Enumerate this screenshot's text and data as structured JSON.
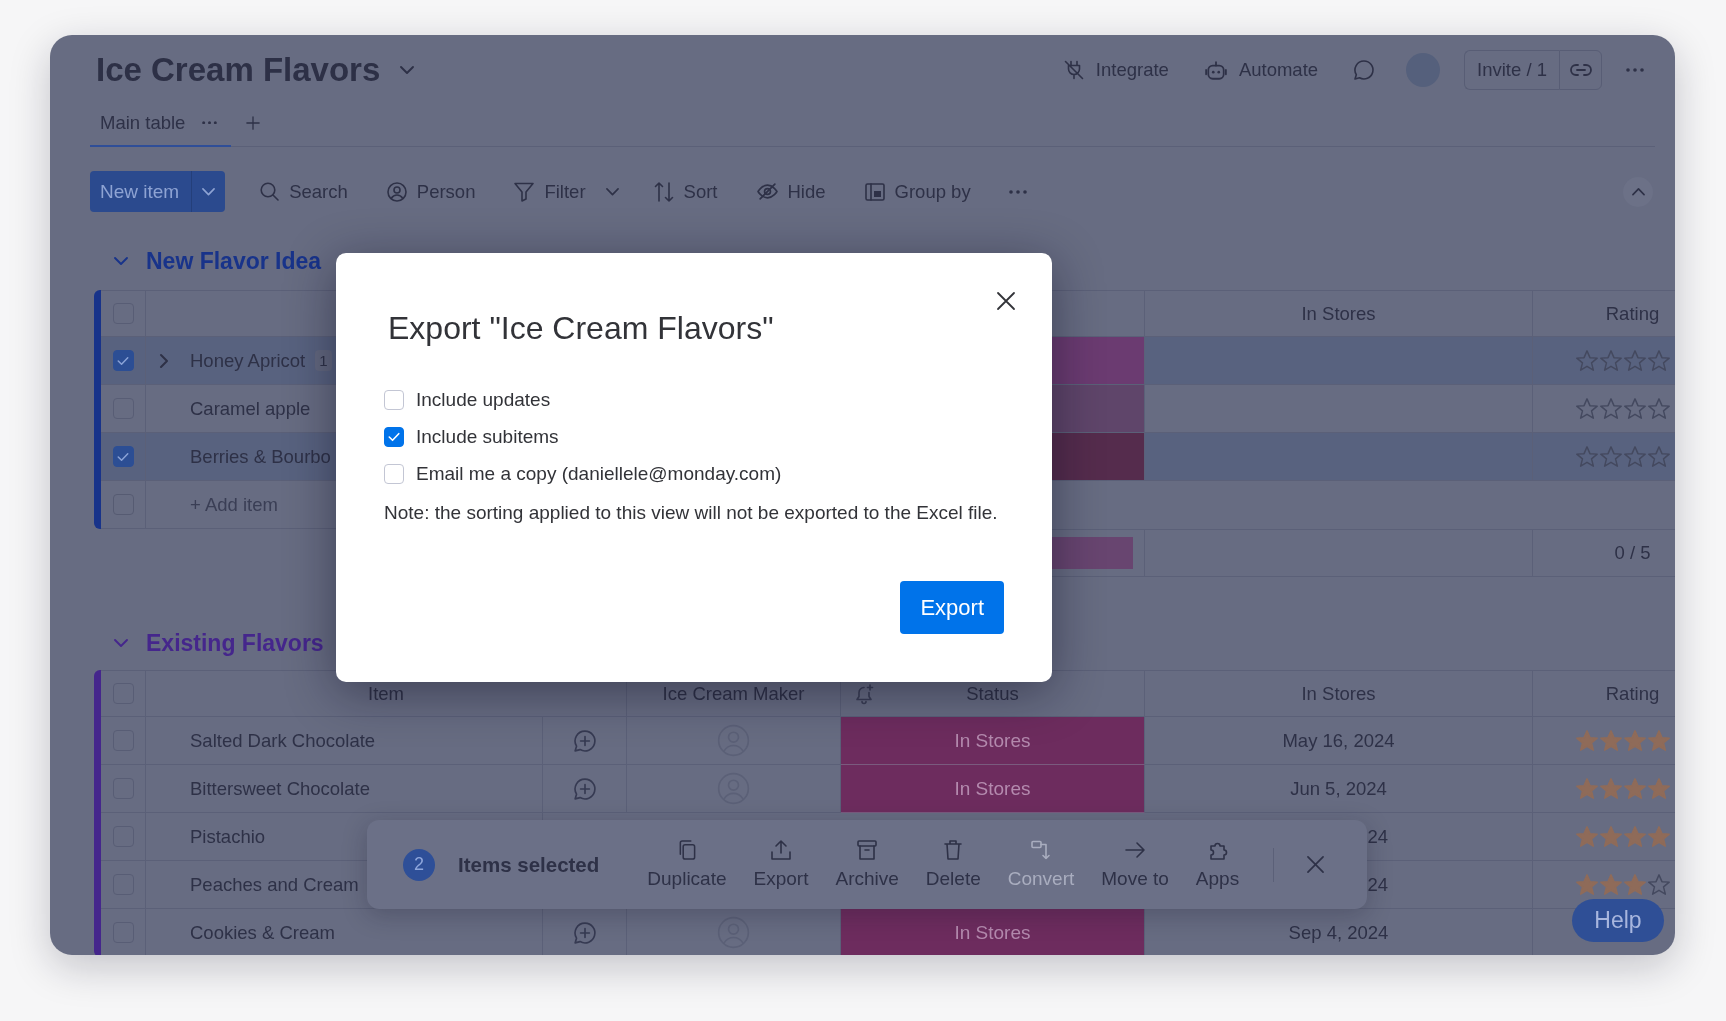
{
  "board": {
    "title": "Ice Cream Flavors"
  },
  "header_actions": [
    {
      "kind": "integrate",
      "label": "Integrate"
    },
    {
      "kind": "automate",
      "label": "Automate"
    }
  ],
  "invite": {
    "label": "Invite / 1"
  },
  "views": [
    {
      "label": "Main table",
      "selected": true
    }
  ],
  "toolbar": {
    "new_item": "New item",
    "tools": [
      {
        "kind": "search",
        "label": "Search"
      },
      {
        "kind": "person",
        "label": "Person"
      },
      {
        "kind": "filter",
        "label": "Filter"
      },
      {
        "kind": "sort",
        "label": "Sort"
      },
      {
        "kind": "hide",
        "label": "Hide"
      },
      {
        "kind": "group",
        "label": "Group by"
      }
    ]
  },
  "groups": [
    {
      "title": "New Flavor Idea",
      "color": "#18338a",
      "expanded": true,
      "select_all": false,
      "columns": [
        {
          "kind": "in_stores",
          "label": "In Stores"
        },
        {
          "kind": "rating",
          "label": "Rating"
        }
      ],
      "rows": [
        {
          "kind": "under_dialog",
          "name": "Honey Apricot",
          "subitems": "1",
          "checked": true,
          "status": {
            "color": "#6b3b71"
          },
          "stars": 0
        },
        {
          "kind": "under_dialog",
          "name": "Caramel apple",
          "checked": false,
          "status": {
            "color": "#5f456a"
          },
          "stars": 0
        },
        {
          "kind": "under_dialog",
          "name": "Berries & Bourbo",
          "checked": true,
          "status": {
            "color": "#552c4d"
          },
          "stars": 0
        }
      ],
      "add_item": {
        "placeholder": "+ Add item",
        "disabled": true
      },
      "summary": {
        "status_bar": {
          "color": "#684570"
        },
        "rating": "0 / 5"
      }
    },
    {
      "title": "Existing Flavors",
      "color": "#45268c",
      "expanded": true,
      "select_all": false,
      "columns": [
        {
          "kind": "item",
          "label": "Item"
        },
        {
          "kind": "maker",
          "label": "Ice Cream Maker"
        },
        {
          "kind": "status",
          "label": "Status"
        },
        {
          "kind": "in_stores",
          "label": "In Stores"
        },
        {
          "kind": "rating",
          "label": "Rating"
        }
      ],
      "rows": [
        {
          "kind": "full",
          "name": "Salted Dark Chocolate",
          "checked": false,
          "status": {
            "label": "In Stores",
            "color": "#6d2c5e"
          },
          "date": "May 16, 2024",
          "stars": 4
        },
        {
          "kind": "full",
          "name": "Bittersweet Chocolate",
          "checked": false,
          "status": {
            "label": "In Stores",
            "color": "#6d2c5e"
          },
          "date": "Jun 5, 2024",
          "stars": 4
        },
        {
          "kind": "under_bar",
          "name": "Pistachio",
          "checked": false,
          "date": "24",
          "stars": 4
        },
        {
          "kind": "under_bar",
          "name": "Peaches and Cream",
          "checked": false,
          "date": "24",
          "stars": 3
        },
        {
          "kind": "full",
          "name": "Cookies & Cream",
          "checked": false,
          "status": {
            "label": "In Stores",
            "color": "#6d2c5e"
          },
          "date": "Sep 4, 2024"
        }
      ]
    }
  ],
  "dialog": {
    "title": "Export \"Ice Cream Flavors\"",
    "options": [
      {
        "label": "Include updates",
        "checked": false
      },
      {
        "label": "Include subitems",
        "checked": true
      },
      {
        "label": "Email me a copy (daniellele@monday.com)",
        "checked": false
      }
    ],
    "note": "Note: the sorting applied to this view will not be exported to the Excel file.",
    "button": "Export"
  },
  "selection": {
    "count": "2",
    "label": "Items selected",
    "actions": [
      {
        "kind": "duplicate",
        "label": "Duplicate",
        "disabled": false
      },
      {
        "kind": "export",
        "label": "Export",
        "disabled": false
      },
      {
        "kind": "archive",
        "label": "Archive",
        "disabled": false
      },
      {
        "kind": "delete",
        "label": "Delete",
        "disabled": false
      },
      {
        "kind": "convert",
        "label": "Convert",
        "disabled": true
      },
      {
        "kind": "move",
        "label": "Move to",
        "disabled": false
      },
      {
        "kind": "apps",
        "label": "Apps",
        "disabled": false
      }
    ]
  },
  "help": {
    "label": "Help"
  }
}
